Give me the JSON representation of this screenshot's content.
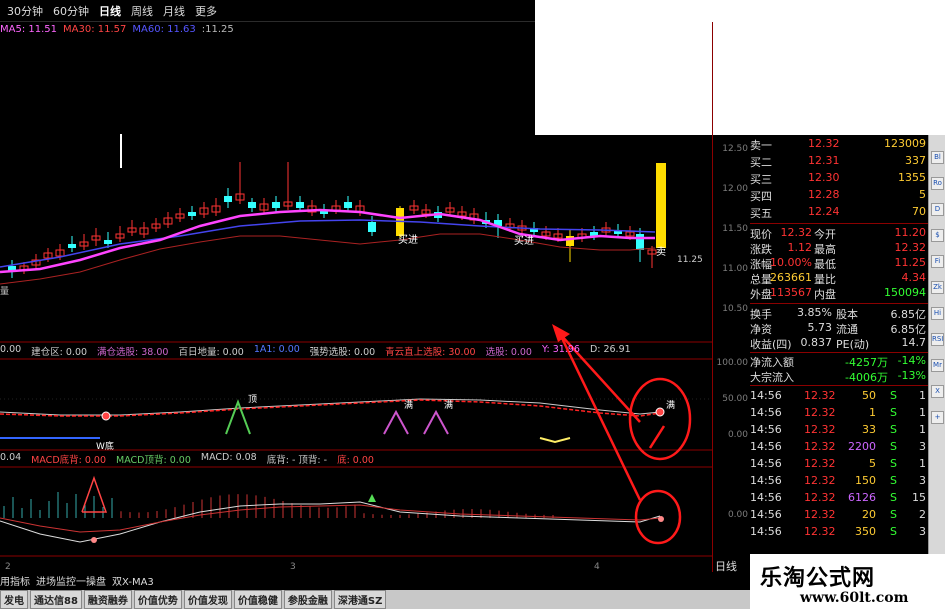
{
  "periods": [
    {
      "label": "30分钟",
      "active": false
    },
    {
      "label": "60分钟",
      "active": false
    },
    {
      "label": "日线",
      "active": true
    },
    {
      "label": "周线",
      "active": false
    },
    {
      "label": "月线",
      "active": false
    },
    {
      "label": "更多",
      "active": false
    }
  ],
  "ma_bar": [
    {
      "text": "MA5: 11.51",
      "color": "#ff66ff"
    },
    {
      "text": "MA30: 11.57",
      "color": "#ff4444"
    },
    {
      "text": "MA60: 11.63",
      "color": "#5555ff"
    },
    {
      "text": ":11.25",
      "color": "#bbbbbb"
    }
  ],
  "price_axis": [
    "12.50",
    "12.00",
    "11.50",
    "11.00",
    "10.50"
  ],
  "ind1_axis": [
    "100.00",
    "50.00",
    "0.00"
  ],
  "ind2_axis": [
    "0.00"
  ],
  "chart_labels": {
    "buy1": "买进",
    "buy2": "买进",
    "sell": "卖",
    "last_price": "11.25",
    "pick1": "顶",
    "pick2": "满",
    "pick3": "满",
    "pick4": "满",
    "wbottom": "W底",
    "left_mark": "量"
  },
  "ind_bar1": [
    {
      "text": "0.00",
      "color": "#cccccc"
    },
    {
      "text": "建仓区: 0.00",
      "color": "#cccccc"
    },
    {
      "text": "满仓选股: 38.00",
      "color": "#cc66cc"
    },
    {
      "text": "百日地量: 0.00",
      "color": "#cccccc"
    },
    {
      "text": "1A1: 0.00",
      "color": "#5577ff"
    },
    {
      "text": "强势选股: 0.00",
      "color": "#cccccc"
    },
    {
      "text": "青云直上选股: 30.00",
      "color": "#ff4444"
    },
    {
      "text": "选股: 0.00",
      "color": "#cc66cc"
    },
    {
      "text": "Y: 31.96",
      "color": "#ff66ff"
    },
    {
      "text": "D: 26.91",
      "color": "#cccccc"
    }
  ],
  "ind_bar2": [
    {
      "text": "0.04",
      "color": "#cccccc"
    },
    {
      "text": "MACD底背: 0.00",
      "color": "#ff4444"
    },
    {
      "text": "MACD顶背: 0.00",
      "color": "#66cc66"
    },
    {
      "text": "MACD: 0.08",
      "color": "#cccccc"
    },
    {
      "text": "底背: - 顶背: -",
      "color": "#cccccc"
    },
    {
      "text": "底: 0.00",
      "color": "#ff4444"
    }
  ],
  "x_ticks": [
    "2",
    "3",
    "4"
  ],
  "day_label": "日线",
  "order_book": [
    {
      "label": "卖一",
      "price": "12.32",
      "vol": "123009"
    },
    {
      "label": "买二",
      "price": "12.31",
      "vol": "337"
    },
    {
      "label": "买三",
      "price": "12.30",
      "vol": "1355"
    },
    {
      "label": "买四",
      "price": "12.28",
      "vol": "5"
    },
    {
      "label": "买五",
      "price": "12.24",
      "vol": "70"
    }
  ],
  "stats": [
    {
      "l1": "现价",
      "v1": "12.32",
      "c1": "#ff3333",
      "l2": "今开",
      "v2": "11.20",
      "c2": "#ff3333"
    },
    {
      "l1": "涨跌",
      "v1": "1.12",
      "c1": "#ff3333",
      "l2": "最高",
      "v2": "12.32",
      "c2": "#ff3333"
    },
    {
      "l1": "涨幅",
      "v1": "10.00%",
      "c1": "#ff3333",
      "l2": "最低",
      "v2": "11.25",
      "c2": "#ff3333"
    },
    {
      "l1": "总量",
      "v1": "263661",
      "c1": "#ffcc33",
      "l2": "量比",
      "v2": "4.34",
      "c2": "#ff3333"
    },
    {
      "l1": "外盘",
      "v1": "113567",
      "c1": "#ff3333",
      "l2": "内盘",
      "v2": "150094",
      "c2": "#33ff33"
    }
  ],
  "stats2": [
    {
      "l1": "换手",
      "v1": "3.85%",
      "l2": "股本",
      "v2": "6.85亿"
    },
    {
      "l1": "净资",
      "v1": "5.73",
      "l2": "流通",
      "v2": "6.85亿"
    },
    {
      "l1": "收益(四)",
      "v1": "0.837",
      "l2": "PE(动)",
      "v2": "14.7"
    }
  ],
  "flows": [
    {
      "label": "净流入额",
      "value": "-4257万",
      "pct": "-14%"
    },
    {
      "label": "大宗流入",
      "value": "-4006万",
      "pct": "-13%"
    }
  ],
  "ticks": [
    {
      "t": "14:56",
      "p": "12.32",
      "v": "50",
      "s": "S",
      "n": "1",
      "vc": "#ffcc33"
    },
    {
      "t": "14:56",
      "p": "12.32",
      "v": "1",
      "s": "S",
      "n": "1",
      "vc": "#ffcc33"
    },
    {
      "t": "14:56",
      "p": "12.32",
      "v": "33",
      "s": "S",
      "n": "1",
      "vc": "#ffcc33"
    },
    {
      "t": "14:56",
      "p": "12.32",
      "v": "2200",
      "s": "S",
      "n": "3",
      "vc": "#cc66ff"
    },
    {
      "t": "14:56",
      "p": "12.32",
      "v": "5",
      "s": "S",
      "n": "1",
      "vc": "#ffcc33"
    },
    {
      "t": "14:56",
      "p": "12.32",
      "v": "150",
      "s": "S",
      "n": "3",
      "vc": "#ffcc33"
    },
    {
      "t": "14:56",
      "p": "12.32",
      "v": "6126",
      "s": "S",
      "n": "15",
      "vc": "#cc66ff"
    },
    {
      "t": "14:56",
      "p": "12.32",
      "v": "20",
      "s": "S",
      "n": "2",
      "vc": "#ffcc33"
    },
    {
      "t": "14:56",
      "p": "12.32",
      "v": "350",
      "s": "S",
      "n": "3",
      "vc": "#ffcc33"
    }
  ],
  "tabs1": [
    "用指标",
    "进场监控一操盘",
    "双X-MA3"
  ],
  "tabs2": [
    "发电",
    "通达信88",
    "融资融券",
    "价值优势",
    "价值发现",
    "价值稳健",
    "参股金融",
    "深港通SZ"
  ],
  "toolbar_icons": [
    "Bl",
    "Ro",
    "D",
    "$",
    "Fi",
    "Zk",
    "Hi",
    "RSI",
    "Mr",
    "X",
    "+"
  ],
  "watermark": {
    "title": "乐淘公式网",
    "url": "www.60lt.com"
  },
  "colors": {
    "up": "#ff3333",
    "down": "#33ffff",
    "ma5": "#ff66ff",
    "ma30": "#ff4444",
    "ma60": "#5555ff",
    "annot": "#ff2020"
  }
}
